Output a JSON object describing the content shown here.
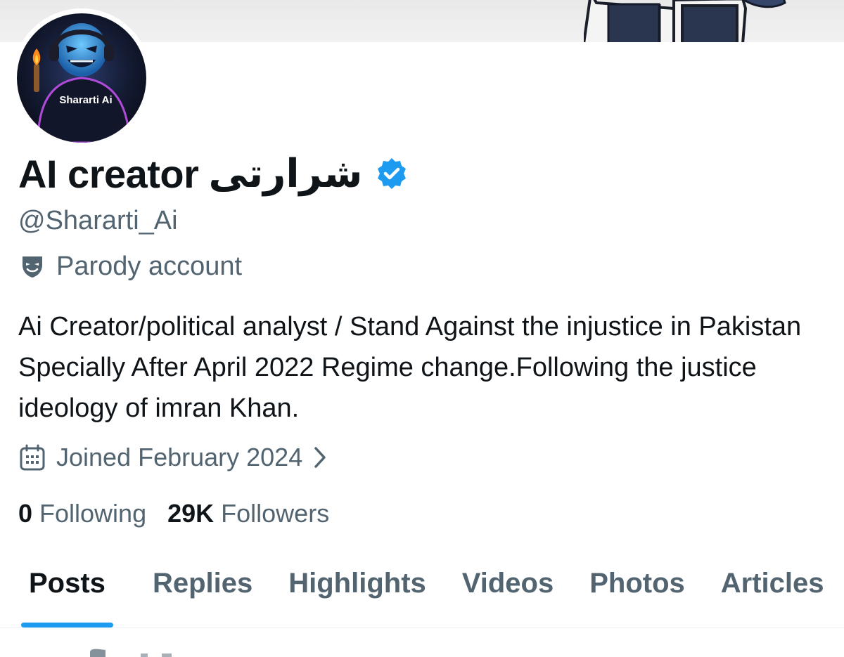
{
  "profile": {
    "display_name": "AI creator",
    "display_name_urdu": "شرارتی",
    "handle": "@Shararti_Ai",
    "avatar_label": "Shararti Ai",
    "label_badge": "Parody account",
    "bio": "Ai Creator/political analyst / Stand Against the injustice in Pakistan Specially After April 2022 Regime change.Following the justice ideology of imran Khan.",
    "joined": "Joined February 2024",
    "stats": {
      "following_count": "0",
      "following_label": "Following",
      "followers_count": "29K",
      "followers_label": "Followers"
    }
  },
  "tabs": [
    {
      "label": "Posts",
      "active": true
    },
    {
      "label": "Replies",
      "active": false
    },
    {
      "label": "Highlights",
      "active": false
    },
    {
      "label": "Videos",
      "active": false
    },
    {
      "label": "Photos",
      "active": false
    },
    {
      "label": "Articles",
      "active": false
    }
  ],
  "icons": {
    "verified": "verified-badge-icon",
    "parody": "theater-mask-icon",
    "joined": "calendar-icon",
    "joined_more": "chevron-right-icon"
  },
  "colors": {
    "accent": "#1d9bf0",
    "text_primary": "#0f1419",
    "text_secondary": "#536471"
  }
}
